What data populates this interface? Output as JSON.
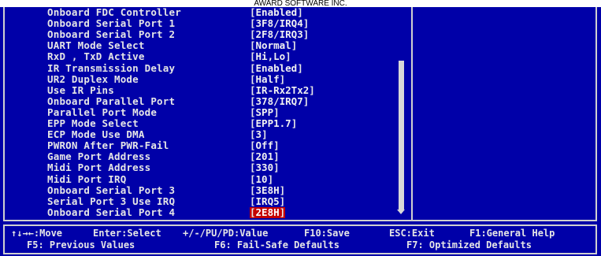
{
  "header": {
    "vendor": "AWARD SOFTWARE INC."
  },
  "settings": [
    {
      "label": "Onboard FDC Controller",
      "value": "Enabled"
    },
    {
      "label": "Onboard Serial Port 1",
      "value": "3F8/IRQ4"
    },
    {
      "label": "Onboard Serial Port 2",
      "value": "2F8/IRQ3"
    },
    {
      "label": "UART Mode Select",
      "value": "Normal"
    },
    {
      "label": "RxD , TxD Active",
      "value": "Hi,Lo"
    },
    {
      "label": "IR Transmission Delay",
      "value": "Enabled"
    },
    {
      "label": "UR2 Duplex Mode",
      "value": "Half"
    },
    {
      "label": "Use IR Pins",
      "value": "IR-Rx2Tx2"
    },
    {
      "label": "Onboard Parallel Port",
      "value": "378/IRQ7"
    },
    {
      "label": "Parallel Port Mode",
      "value": "SPP"
    },
    {
      "label": "EPP Mode Select",
      "value": "EPP1.7"
    },
    {
      "label": "ECP Mode Use DMA",
      "value": "3"
    },
    {
      "label": "PWRON After PWR-Fail",
      "value": "Off"
    },
    {
      "label": "Game Port Address",
      "value": "201"
    },
    {
      "label": "Midi Port Address",
      "value": "330"
    },
    {
      "label": "Midi Port IRQ",
      "value": "10"
    },
    {
      "label": "Onboard Serial Port 3",
      "value": "3E8H"
    },
    {
      "label": "Serial Port 3 Use IRQ",
      "value": "IRQ5"
    },
    {
      "label": "Onboard Serial Port 4",
      "value": "2E8H",
      "selected": true
    }
  ],
  "footer": {
    "move": "↑↓→←:Move",
    "select": "Enter:Select",
    "value": "+/-/PU/PD:Value",
    "save": "F10:Save",
    "exit": "ESC:Exit",
    "help": "F1:General Help",
    "previous": "F5: Previous Values",
    "failsafe": "F6: Fail-Safe Defaults",
    "optimized": "F7: Optimized Defaults"
  },
  "colors": {
    "background": "#0000a8",
    "text": "#e6e6e6",
    "selected_bg": "#c40000"
  }
}
